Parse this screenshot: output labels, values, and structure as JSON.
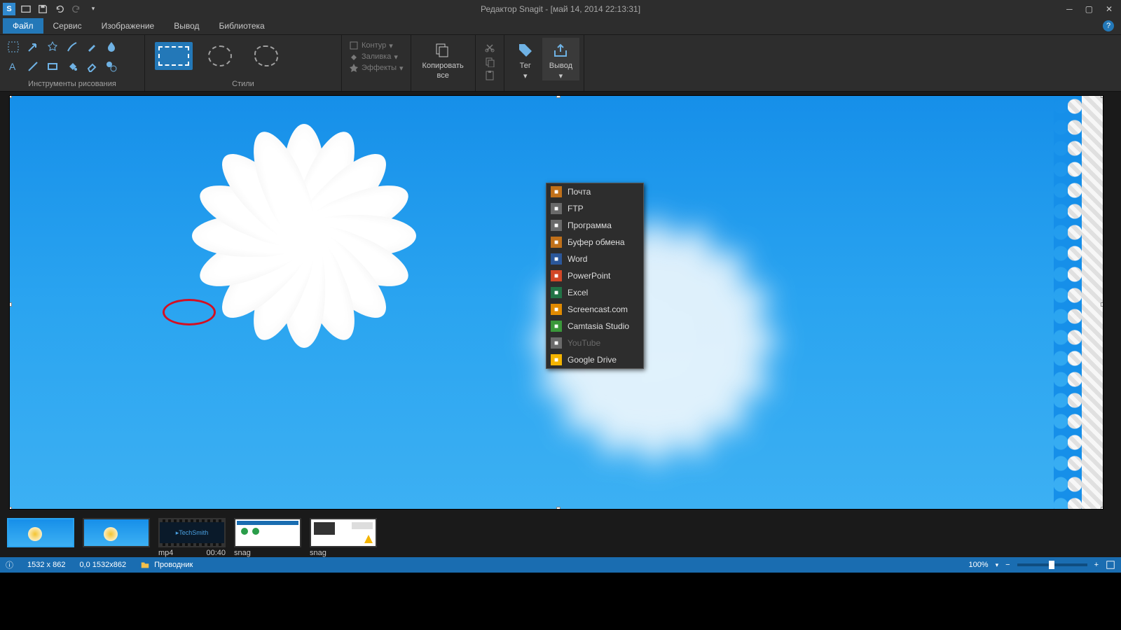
{
  "title": "Редактор Snagit - [май 14, 2014 22:13:31]",
  "menu": {
    "file": "Файл",
    "service": "Сервис",
    "image": "Изображение",
    "output": "Вывод",
    "library": "Библиотека"
  },
  "ribbon": {
    "group_tools": "Инструменты рисования",
    "group_styles": "Стили",
    "outline": "Контур",
    "fill": "Заливка",
    "effects": "Эффекты",
    "copy_all_1": "Копировать",
    "copy_all_2": "все",
    "tags": "Тег",
    "share": "Вывод"
  },
  "dropdown": [
    {
      "label": "Почта",
      "color": "#c0701a"
    },
    {
      "label": "FTP",
      "color": "#6a6a6a"
    },
    {
      "label": "Программа",
      "color": "#6a6a6a"
    },
    {
      "label": "Буфер обмена",
      "color": "#c0701a"
    },
    {
      "label": "Word",
      "color": "#2b579a"
    },
    {
      "label": "PowerPoint",
      "color": "#d24726"
    },
    {
      "label": "Excel",
      "color": "#217346"
    },
    {
      "label": "Screencast.com",
      "color": "#e08a00"
    },
    {
      "label": "Camtasia Studio",
      "color": "#3a983a"
    },
    {
      "label": "YouTube",
      "color": "#6a6a6a",
      "disabled": true
    },
    {
      "label": "Google Drive",
      "color": "#f4b400"
    }
  ],
  "thumbs": [
    {
      "type": "img",
      "sel": true
    },
    {
      "type": "img"
    },
    {
      "type": "vid",
      "l": "mp4",
      "r": "00:40"
    },
    {
      "type": "doc",
      "l": "snag"
    },
    {
      "type": "doc2",
      "l": "snag"
    }
  ],
  "status": {
    "dim": "1532 x 862",
    "coord": "0,0  1532x862",
    "explorer": "Проводник",
    "zoom": "100%"
  }
}
